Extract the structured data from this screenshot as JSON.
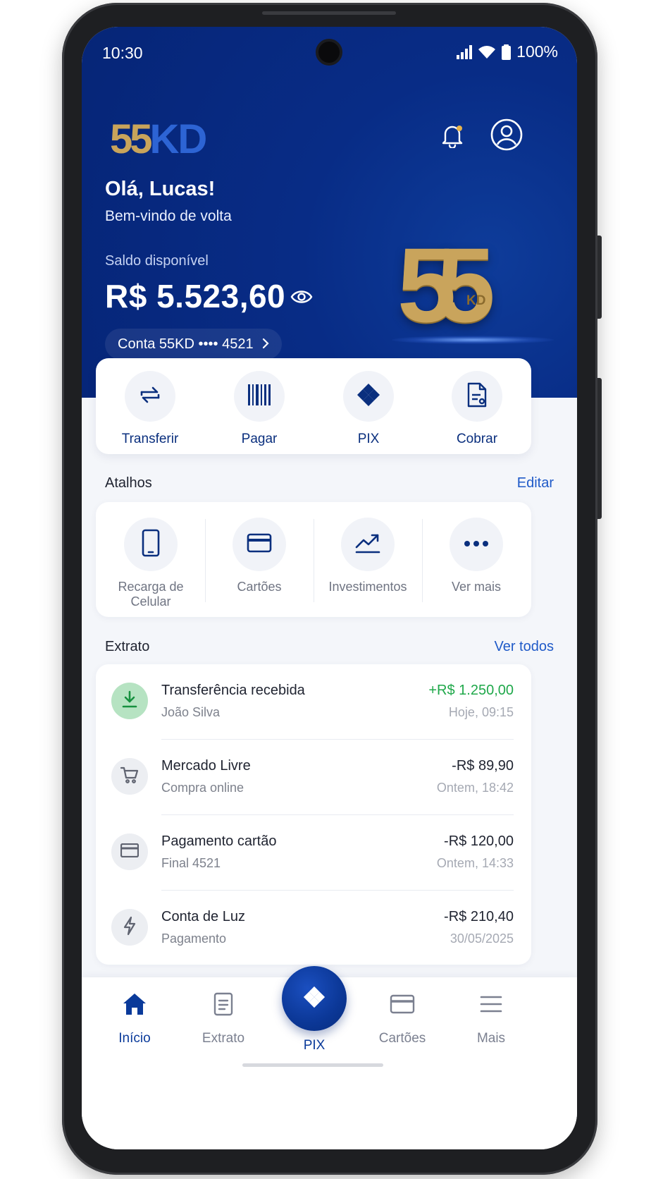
{
  "status_bar": {
    "time": "10:30",
    "battery": "100%"
  },
  "header": {
    "logo": {
      "gold": "55",
      "blue": "KD"
    },
    "greeting": "Olá, Lucas!",
    "welcome": "Bem-vindo de volta",
    "balance_label": "Saldo disponível",
    "balance_value": "R$ 5.523,60",
    "account": "Conta 55KD •••• 4521",
    "emblem": {
      "number": "55",
      "letters": "KD"
    },
    "icons": [
      "bell-icon",
      "profile-icon",
      "eye-icon"
    ]
  },
  "quick_actions": [
    {
      "label": "Transferir",
      "icon": "transfer-icon"
    },
    {
      "label": "Pagar",
      "icon": "barcode-icon"
    },
    {
      "label": "PIX",
      "icon": "pix-icon"
    },
    {
      "label": "Cobrar",
      "icon": "invoice-icon"
    }
  ],
  "shortcuts": {
    "title": "Atalhos",
    "edit": "Editar",
    "items": [
      {
        "label": "Recarga de Celular",
        "icon": "phone-icon"
      },
      {
        "label": "Cartões",
        "icon": "card-icon"
      },
      {
        "label": "Investimentos",
        "icon": "chart-icon"
      },
      {
        "label": "Ver mais",
        "icon": "more-icon"
      }
    ]
  },
  "statement": {
    "title": "Extrato",
    "see_all": "Ver todos",
    "transactions": [
      {
        "title": "Transferência recebida",
        "subtitle": "João Silva",
        "amount": "+R$ 1.250,00",
        "date": "Hoje, 09:15",
        "icon": "download-icon",
        "positive": true
      },
      {
        "title": "Mercado Livre",
        "subtitle": "Compra online",
        "amount": "-R$ 89,90",
        "date": "Ontem, 18:42",
        "icon": "cart-icon",
        "positive": false
      },
      {
        "title": "Pagamento cartão",
        "subtitle": "Final 4521",
        "amount": "-R$ 120,00",
        "date": "Ontem, 14:33",
        "icon": "card-icon",
        "positive": false
      },
      {
        "title": "Conta de Luz",
        "subtitle": "Pagamento",
        "amount": "-R$ 210,40",
        "date": "30/05/2025",
        "icon": "bolt-icon",
        "positive": false
      }
    ]
  },
  "bottom_nav": {
    "items": [
      {
        "label": "Início",
        "icon": "home-icon",
        "active": true
      },
      {
        "label": "Extrato",
        "icon": "statement-icon",
        "active": false
      },
      {
        "label": "PIX",
        "icon": "pix-icon",
        "active": false
      },
      {
        "label": "Cartões",
        "icon": "card-icon",
        "active": false
      },
      {
        "label": "Mais",
        "icon": "menu-icon",
        "active": false
      }
    ]
  },
  "colors": {
    "primary": "#062577",
    "gold": "#c9a45c",
    "positive": "#1fa84a",
    "link": "#1f5ac8"
  }
}
